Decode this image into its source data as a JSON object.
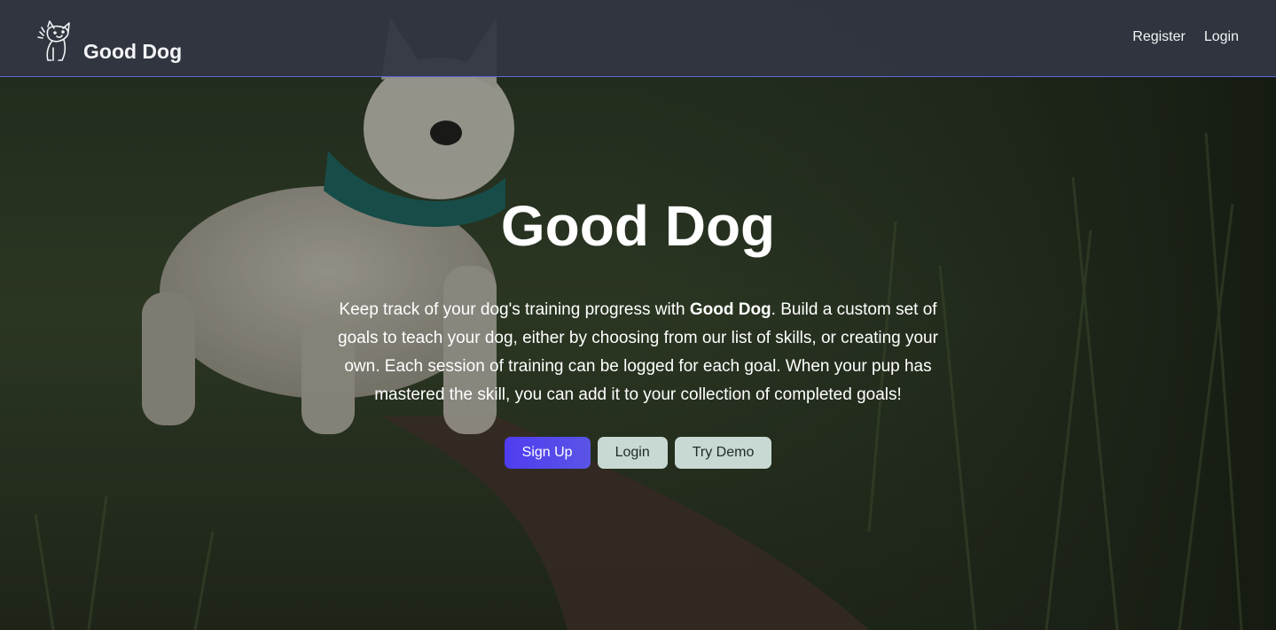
{
  "nav": {
    "brand": "Good Dog",
    "links": {
      "register": "Register",
      "login": "Login"
    }
  },
  "hero": {
    "title": "Good Dog",
    "description": {
      "before": "Keep track of your dog's training progress with ",
      "bold": "Good Dog",
      "after": ". Build a custom set of goals to teach your dog, either by choosing from our list of skills, or creating your own. Each session of training can be logged for each goal. When your pup has mastered the skill, you can add it to your collection of completed goals!"
    },
    "buttons": {
      "signup": "Sign Up",
      "login": "Login",
      "demo": "Try Demo"
    }
  },
  "colors": {
    "navbar": "#313642",
    "navbar_border": "#5a6bd8",
    "primary_button": "#4f3df0",
    "secondary_button": "#c8d9d3"
  },
  "icons": {
    "logo": "dog-logo-icon"
  }
}
